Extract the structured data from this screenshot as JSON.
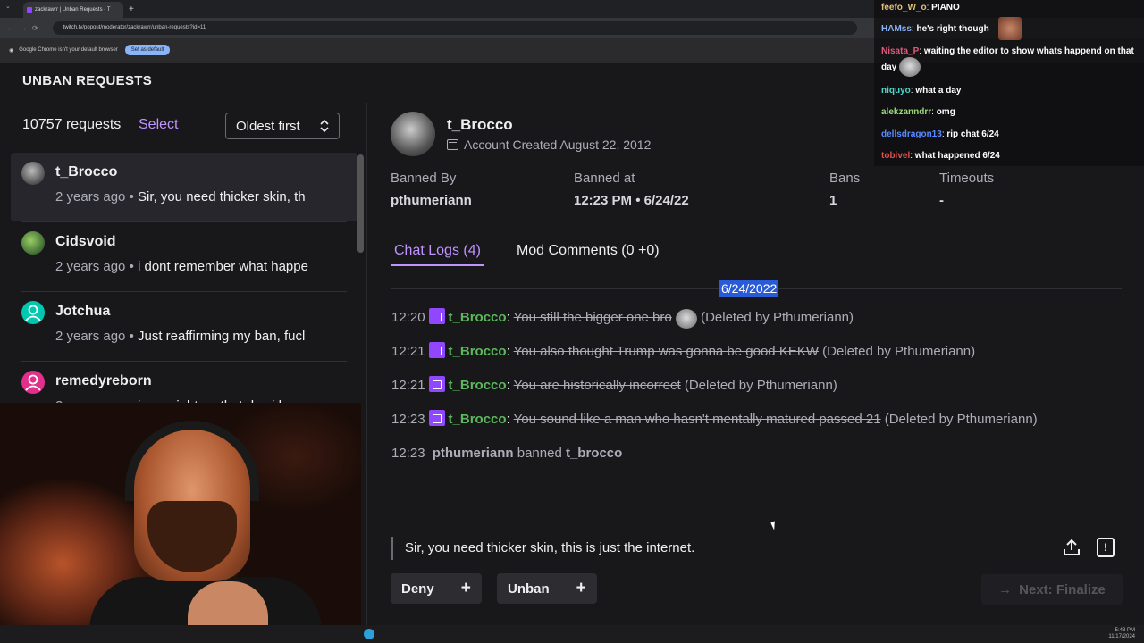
{
  "browser": {
    "tab_title": "zackrawrr | Unban Requests - T",
    "url": "twitch.tv/popout/moderator/zackrawrr/unban-requests?id=11",
    "infobar_text": "Google Chrome isn't your default browser",
    "set_default_label": "Set as default",
    "new_tab_symbol": "+"
  },
  "page": {
    "title": "UNBAN REQUESTS"
  },
  "sidebar": {
    "count": "10757 requests",
    "select_label": "Select",
    "sort_label": "Oldest first",
    "items": [
      {
        "name": "t_Brocco",
        "age": "2 years ago",
        "bullet": "•",
        "message": "Sir, you need thicker skin, th",
        "avatar_color": "#777777"
      },
      {
        "name": "Cidsvoid",
        "age": "2 years ago",
        "bullet": "•",
        "message": "i dont remember what happe",
        "avatar_color": "#5a8a4a"
      },
      {
        "name": "Jotchua",
        "age": "2 years ago",
        "bullet": "•",
        "message": "Just reaffirming my ban, fucl",
        "avatar_color": "#00c8af"
      },
      {
        "name": "remedyreborn",
        "age": "2 years ago",
        "bullet": "•",
        "message": "i was right on that day i hers",
        "avatar_color": "#e0308a"
      }
    ]
  },
  "detail": {
    "username": "t_Brocco",
    "account_created": "Account Created August 22, 2012",
    "stats": [
      {
        "label": "Banned By",
        "value": "pthumeriann"
      },
      {
        "label": "Banned at",
        "value": "12:23 PM • 6/24/22"
      },
      {
        "label": "Bans",
        "value": "1"
      },
      {
        "label": "Timeouts",
        "value": "-"
      }
    ],
    "tabs": [
      {
        "label": "Chat Logs (4)",
        "active": true
      },
      {
        "label": "Mod Comments (0 +0)",
        "active": false
      }
    ],
    "date_marker": "6/24/2022",
    "chat": [
      {
        "time": "12:20",
        "user": "t_Brocco",
        "sep": ":",
        "text": "You still the bigger one bro",
        "note": "(Deleted by Pthumeriann)"
      },
      {
        "time": "12:21",
        "user": "t_Brocco",
        "sep": ":",
        "text": "You also thought Trump was gonna be good KEKW",
        "note": "(Deleted by Pthumeriann)"
      },
      {
        "time": "12:21",
        "user": "t_Brocco",
        "sep": ":",
        "text": "You are historically incorrect",
        "note": "(Deleted by Pthumeriann)"
      },
      {
        "time": "12:23",
        "user": "t_Brocco",
        "sep": ":",
        "text": "You sound like a man who hasn't mentally matured passed 21",
        "note": "(Deleted by Pthumeriann)"
      }
    ],
    "ban_event": {
      "time": "12:23",
      "mod": "pthumeriann",
      "action": "banned",
      "target": "t_brocco"
    },
    "request_text": "Sir, you need thicker skin, this is just the internet.",
    "deny_label": "Deny",
    "unban_label": "Unban",
    "plus_symbol": "+",
    "next_label": "Next: Finalize",
    "arrow_symbol": "→",
    "report_symbol": "!"
  },
  "stream_chat": [
    {
      "name": "feefo_W_o",
      "color": "#e6c07a",
      "text": "PIANO"
    },
    {
      "name": "HAMss",
      "color": "#8ab4f8",
      "text": "he's right though"
    },
    {
      "name": "Nisata_P",
      "color": "#e05a7a",
      "text": "waiting the editor to show whats happend on that day"
    },
    {
      "name": "niquyo",
      "color": "#4fd8c8",
      "text": "what a day"
    },
    {
      "name": "alekzanndrr",
      "color": "#9ad87a",
      "text": "omg"
    },
    {
      "name": "dellsdragon13",
      "color": "#5a8aff",
      "text": "rip chat 6/24"
    },
    {
      "name": "tobivel",
      "color": "#e05050",
      "text": "what happened 6/24"
    }
  ],
  "taskbar": {
    "time": "5:48 PM",
    "date": "11/17/2024"
  }
}
